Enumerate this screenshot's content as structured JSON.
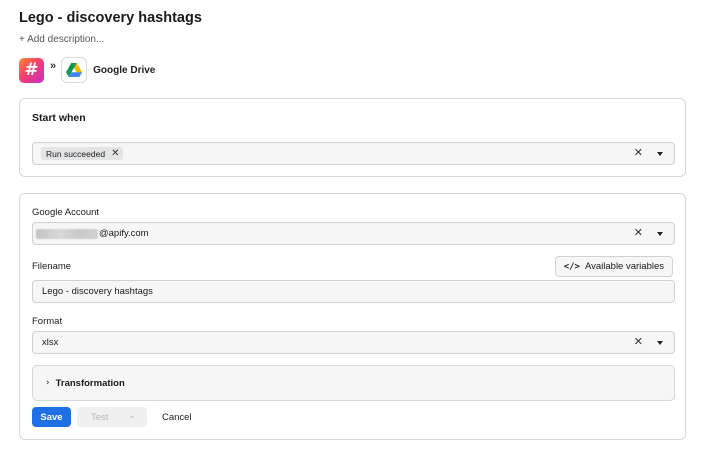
{
  "page": {
    "title": "Lego - discovery hashtags",
    "add_description": "+ Add description..."
  },
  "integration": {
    "source_icon": "hashtag-app-icon",
    "source_glyph": "#",
    "separator": "»",
    "target_icon": "google-drive-icon",
    "target_name": "Google Drive",
    "colors": {
      "hashtag_gradient": [
        "#ff8a2b",
        "#f43f6b",
        "#c72cd1"
      ],
      "drive": [
        "#0f9d58",
        "#f4b400",
        "#4285f4"
      ]
    }
  },
  "start_when": {
    "heading": "Start when",
    "chips": [
      {
        "label": "Run succeeded"
      }
    ],
    "clear": "✕"
  },
  "drive_form": {
    "account_label": "Google Account",
    "account_value_visible": "@apify.com",
    "filename_label": "Filename",
    "available_variables_button": "Available variables",
    "available_variables_icon": "</>",
    "filename_value": "Lego - discovery hashtags",
    "format_label": "Format",
    "format_value": "xlsx",
    "clear": "✕",
    "transformation_label": "Transformation",
    "transformation_chevron": "›"
  },
  "actions": {
    "save": "Save",
    "test": "Test",
    "test_caret": "⌄",
    "cancel": "Cancel",
    "primary_color": "#1f6fe5"
  }
}
